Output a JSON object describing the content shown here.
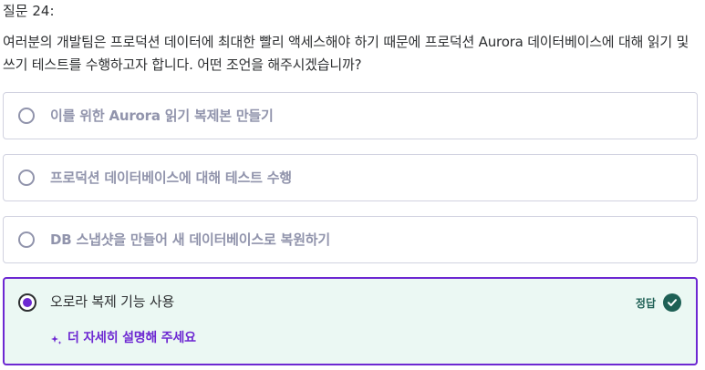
{
  "question": {
    "number_label": "질문 24:",
    "text": "여러분의 개발팀은 프로덕션 데이터에 최대한 빨리 액세스해야 하기 때문에 프로덕션 Aurora 데이터베이스에 대해 읽기 및 쓰기 테스트를 수행하고자 합니다. 어떤 조언을 해주시겠습니까?"
  },
  "options": [
    {
      "label": "이를 위한 Aurora 읽기 복제본 만들기",
      "selected": false
    },
    {
      "label": "프로덕션 데이터베이스에 대해 테스트 수행",
      "selected": false
    },
    {
      "label": "DB 스냅샷을 만들어 새 데이터베이스로 복원하기",
      "selected": false
    },
    {
      "label": "오로라 복제 기능 사용",
      "selected": true
    }
  ],
  "correct": {
    "badge_label": "정답"
  },
  "explain": {
    "label": "더 자세히 설명해 주세요"
  },
  "colors": {
    "accent": "#6d28d2",
    "correct": "#1e6055",
    "correct_bg": "#ebf8f3",
    "muted_text": "#9194ac"
  },
  "icons": {
    "correct": "check-circle-icon",
    "explain": "sparkle-icon"
  }
}
